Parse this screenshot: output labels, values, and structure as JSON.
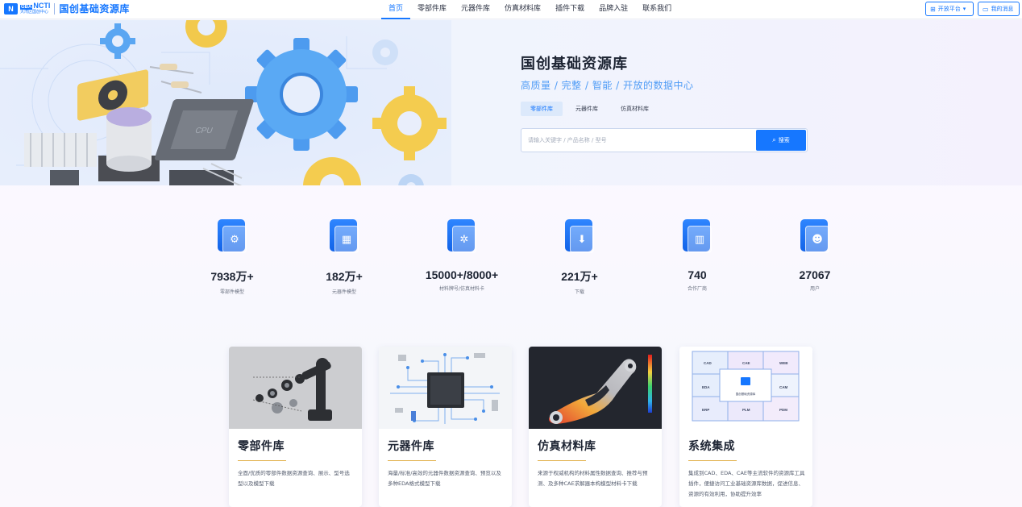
{
  "header": {
    "logo_mark": "N",
    "logo_badge_prefix": "GBA",
    "logo_badge": "NCTI",
    "logo_sub": "大湾区国创中心",
    "logo_title": "国创基础资源库",
    "nav": [
      {
        "label": "首页",
        "active": true
      },
      {
        "label": "零部件库"
      },
      {
        "label": "元器件库"
      },
      {
        "label": "仿真材料库"
      },
      {
        "label": "插件下载"
      },
      {
        "label": "品牌入驻"
      },
      {
        "label": "联系我们"
      }
    ],
    "open_platform": "开放平台",
    "open_platform_caret": "▾",
    "messages": "我的消息"
  },
  "hero": {
    "title": "国创基础资源库",
    "subtitle": "高质量 / 完整 / 智能 / 开放的数据中心",
    "tabs": [
      {
        "label": "零部件库",
        "active": true
      },
      {
        "label": "元器件库"
      },
      {
        "label": "仿真材料库"
      }
    ],
    "search_placeholder": "请输入关键字 / 产品名称 / 型号",
    "search_button": "搜索",
    "chip_label": "CPU"
  },
  "stats": [
    {
      "value": "7938万+",
      "label": "零部件模型",
      "icon": "gear-icon"
    },
    {
      "value": "182万+",
      "label": "元器件模型",
      "icon": "chip-icon"
    },
    {
      "value": "15000+/8000+",
      "label": "材料牌号/仿真材料卡",
      "icon": "gears-icon"
    },
    {
      "value": "221万+",
      "label": "下载",
      "icon": "download-icon"
    },
    {
      "value": "740",
      "label": "合作厂商",
      "icon": "building-icon"
    },
    {
      "value": "27067",
      "label": "用户",
      "icon": "worker-icon"
    }
  ],
  "cards": [
    {
      "title": "零部件库",
      "desc": "全面/优质的零部件数据资源查询、展示、型号选型以及模型下载"
    },
    {
      "title": "元器件库",
      "desc": "海量/标准/高效的元器件数据资源查询、预览以及多种EDA格式模型下载"
    },
    {
      "title": "仿真材料库",
      "desc": "来源于权威机构的材料属性数据查询、推荐与预测、及多种CAE求解器本构模型材料卡下载"
    },
    {
      "title": "系统集成",
      "desc": "集成到CAD、EDA、CAE等主流软件的资源库工具插件，便捷访问工业基础资源库数据，促进信息、资源的有效利用，协助提升效率",
      "puzzle": [
        "CAD",
        "CAE",
        "WEB",
        "EDA",
        "CAM",
        "ERP",
        "PLM",
        "PDM"
      ],
      "puzzle_center": "国创基础资源库"
    }
  ],
  "colors": {
    "accent": "#1677ff",
    "subtitle": "#4f9cf6",
    "divider": "#e1b04a"
  }
}
